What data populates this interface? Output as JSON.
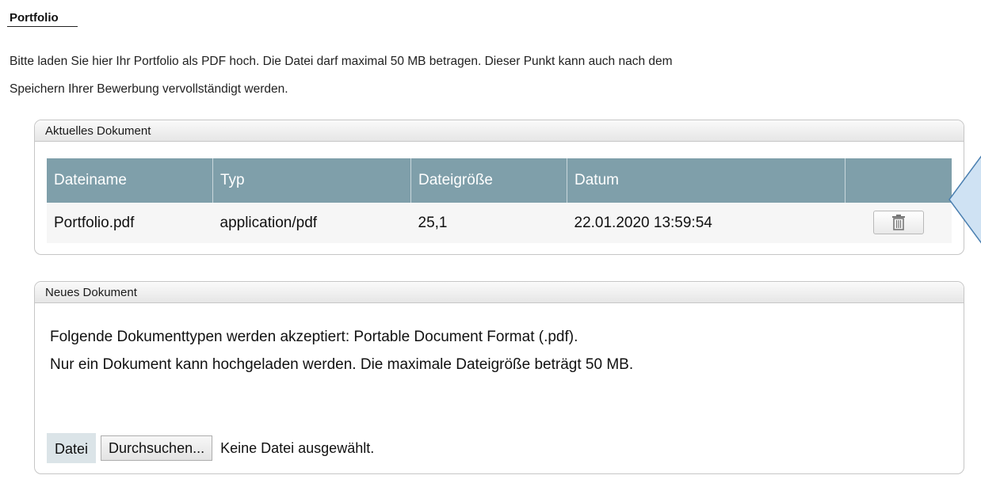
{
  "section": {
    "title": "Portfolio",
    "intro_line1": "Bitte laden Sie hier Ihr Portfolio als PDF hoch. Die Datei darf maximal 50 MB betragen. Dieser Punkt kann auch nach dem",
    "intro_line2": "Speichern Ihrer Bewerbung vervollständigt werden."
  },
  "current_document": {
    "panel_title": "Aktuelles Dokument",
    "columns": [
      "Dateiname",
      "Typ",
      "Dateigröße",
      "Datum",
      ""
    ],
    "rows": [
      {
        "filename": "Portfolio.pdf",
        "type": "application/pdf",
        "size": "25,1",
        "date": "22.01.2020 13:59:54",
        "action_icon": "trash-icon"
      }
    ]
  },
  "new_document": {
    "panel_title": "Neues Dokument",
    "accepted_types_text": "Folgende Dokumenttypen werden akzeptiert: Portable Document Format (.pdf).",
    "limit_text": "Nur ein Dokument kann hochgeladen werden. Die maximale Dateigröße beträgt 50 MB.",
    "file_label": "Datei",
    "browse_label": "Durchsuchen...",
    "no_file_text": "Keine Datei ausgewählt."
  },
  "colors": {
    "table_header": "#7f9faa",
    "callout_fill": "#cfe2f3",
    "callout_stroke": "#4a7fb0"
  }
}
